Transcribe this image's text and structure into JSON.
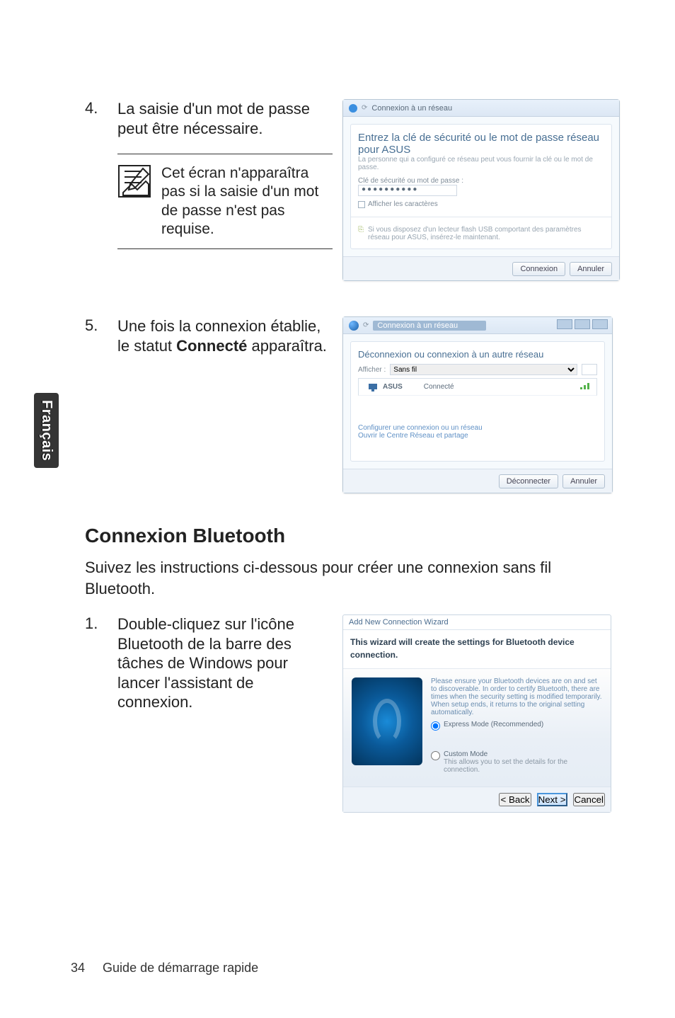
{
  "sideTab": "Français",
  "step4": {
    "num": "4.",
    "text": "La saisie d'un mot de passe peut être nécessaire.",
    "noteText": "Cet écran n'apparaîtra pas si la saisie d'un mot de passe n'est pas requise."
  },
  "passwordDialog": {
    "title": "Connexion à un réseau",
    "heading": "Entrez la clé de sécurité ou le mot de passe réseau pour ASUS",
    "subText": "La personne qui a configuré ce réseau peut vous fournir la clé ou le mot de passe.",
    "fieldLabel": "Clé de sécurité ou mot de passe :",
    "fieldValue": "●●●●●●●●●●",
    "checkboxLabel": "Afficher les caractères",
    "hintText": "Si vous disposez d'un lecteur flash USB comportant des paramètres réseau pour ASUS, insérez-le maintenant.",
    "hintLink": "lecteur flash USB",
    "okButton": "Connexion",
    "cancelButton": "Annuler"
  },
  "step5": {
    "num": "5.",
    "textPrefix": "Une fois la connexion établie, le statut ",
    "textBold": "Connecté",
    "textSuffix": " apparaîtra."
  },
  "connectedDialog": {
    "title": "Connexion à un réseau",
    "heading": "Déconnexion ou connexion à un autre réseau",
    "filterLabel": "Afficher :",
    "filterValue": "Sans fil",
    "colIcon": "",
    "colNetwork": "ASUS",
    "colStatus": "Connecté",
    "link1": "Configurer une connexion ou un réseau",
    "link2": "Ouvrir le Centre Réseau et partage",
    "btn1": "Déconnecter",
    "btn2": "Annuler"
  },
  "sectionHeading": "Connexion Bluetooth",
  "sectionPara": "Suivez les instructions ci-dessous pour créer une connexion sans fil Bluetooth.",
  "step1": {
    "num": "1.",
    "text": "Double-cliquez sur l'icône Bluetooth de la barre des tâches de Windows pour lancer l'assistant de connexion."
  },
  "btWizard": {
    "title": "Add New Connection Wizard",
    "banner": "This wizard will create the settings for Bluetooth device connection.",
    "desc": "Please ensure your Bluetooth devices are on and set to discoverable. In order to certify Bluetooth, there are times when the security setting is modified temporarily. When setup ends, it returns to the original setting automatically.",
    "radio1": "Express Mode (Recommended)",
    "radio2": "Custom Mode",
    "radio2desc": "This allows you to set the details for the connection.",
    "back": "< Back",
    "next": "Next >",
    "cancel": "Cancel"
  },
  "footer": {
    "pageNum": "34",
    "bookTitle": "Guide de démarrage rapide"
  }
}
